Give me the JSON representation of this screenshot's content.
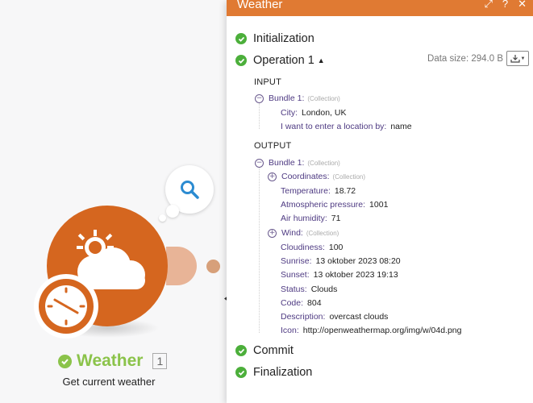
{
  "panel": {
    "title": "Weather",
    "actions": [
      "⤢",
      "?",
      "✕"
    ],
    "data_size": "Data size: 294.0 B",
    "input_label": "INPUT",
    "output_label": "OUTPUT",
    "collection_tag": "(Collection)",
    "operations": {
      "initialization": "Initialization",
      "operation": "Operation 1",
      "commit": "Commit",
      "finalization": "Finalization"
    },
    "input": {
      "bundle": "Bundle 1:",
      "fields": [
        {
          "key": "City:",
          "value": "London, UK"
        },
        {
          "key": "I want to enter a location by:",
          "value": "name"
        }
      ]
    },
    "output": {
      "bundle": "Bundle 1:",
      "fields": [
        {
          "key": "Coordinates:",
          "value": ""
        },
        {
          "key": "Temperature:",
          "value": "18.72"
        },
        {
          "key": "Atmospheric pressure:",
          "value": "1001"
        },
        {
          "key": "Air humidity:",
          "value": "71"
        },
        {
          "key": "Wind:",
          "value": ""
        },
        {
          "key": "Cloudiness:",
          "value": "100"
        },
        {
          "key": "Sunrise:",
          "value": "13 oktober 2023 08:20"
        },
        {
          "key": "Sunset:",
          "value": "13 oktober 2023 19:13"
        },
        {
          "key": "Status:",
          "value": "Clouds"
        },
        {
          "key": "Code:",
          "value": "804"
        },
        {
          "key": "Description:",
          "value": "overcast clouds"
        },
        {
          "key": "Icon:",
          "value": "http://openweathermap.org/img/w/04d.png"
        }
      ]
    }
  },
  "module": {
    "title": "Weather",
    "badge": "1",
    "subtitle": "Get current weather"
  },
  "icons": {
    "search": "search-icon",
    "weather": "sun-cloud-icon",
    "clock": "clock-icon",
    "download": "download-icon"
  },
  "colors": {
    "header": "#e07a33",
    "module": "#d5661f",
    "success": "#4caf3b",
    "module_title": "#8bc34a",
    "key": "#4e3a82"
  }
}
